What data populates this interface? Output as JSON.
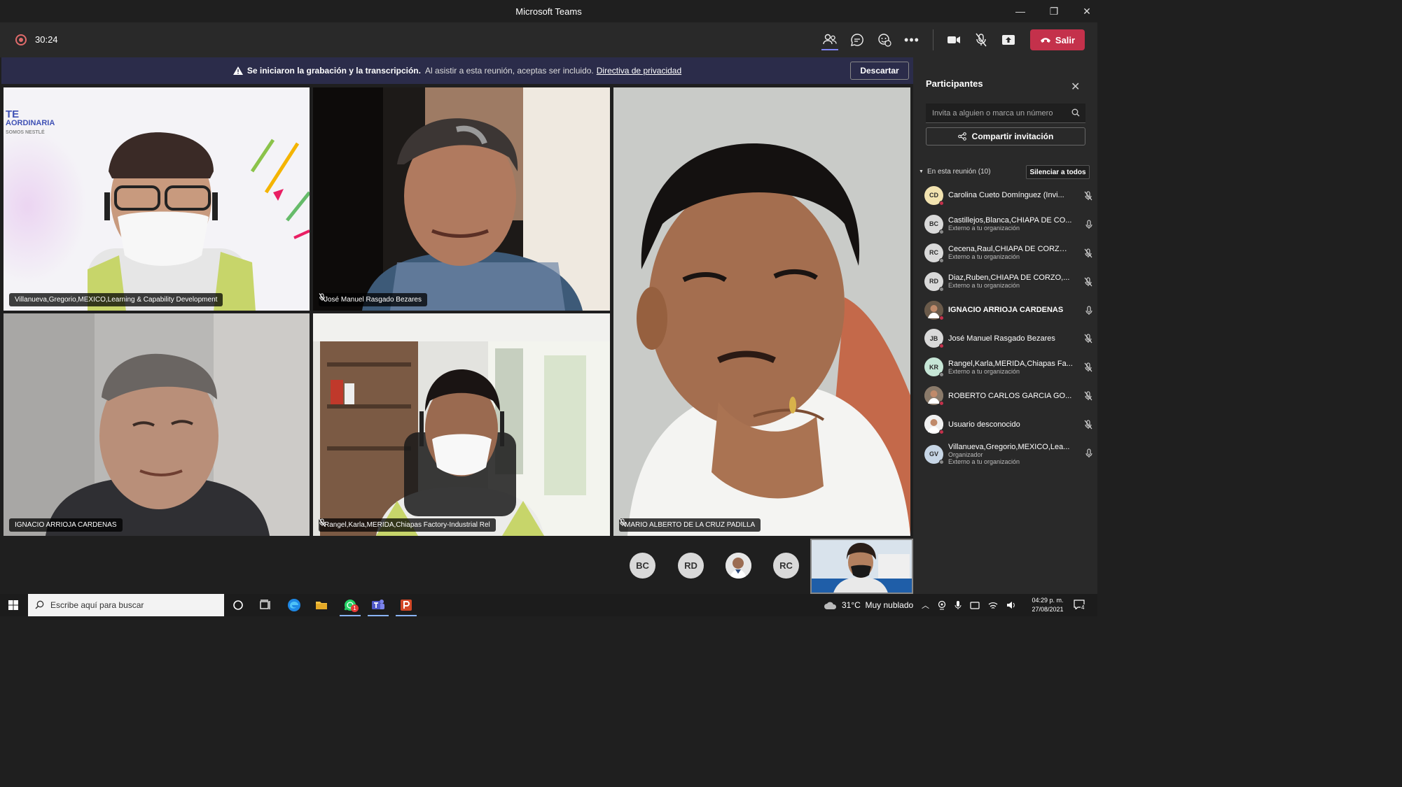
{
  "window": {
    "title": "Microsoft Teams",
    "minimize": "—",
    "maximize": "❐",
    "close": "✕"
  },
  "toolbar": {
    "timer": "30:24",
    "leave_label": "Salir"
  },
  "banner": {
    "bold_text": "Se iniciaron la grabación y la transcripción.",
    "text": "Al asistir a esta reunión, aceptas ser incluido.",
    "link_text": "Directiva de privacidad",
    "dismiss_label": "Descartar"
  },
  "video_tiles": [
    {
      "name": "Villanueva,Gregorio,MEXICO,Learning & Capability Development",
      "muted": false,
      "background_text": [
        "TE",
        "AORDINARIA",
        "SOMOS NESTLÉ"
      ]
    },
    {
      "name": "José Manuel Rasgado Bezares",
      "muted": true
    },
    {
      "name": "MARIO ALBERTO DE LA CRUZ PADILLA",
      "muted": true
    },
    {
      "name": "IGNACIO ARRIOJA CARDENAS",
      "muted": false
    },
    {
      "name": "Rangel,Karla,MERIDA,Chiapas Factory-Industrial Rel",
      "muted": true
    }
  ],
  "participants_panel": {
    "title": "Participantes",
    "invite_placeholder": "Invita a alguien o marca un número",
    "share_label": "Compartir invitación",
    "section_label": "En esta reunión (10)",
    "mute_all_label": "Silenciar a todos",
    "participants": [
      {
        "initials": "CD",
        "name": "Carolina Cueto Domínguez (Invi...",
        "sub": "",
        "sub2": "",
        "color": "#f2e3b0",
        "muted": true,
        "bold": false
      },
      {
        "initials": "BC",
        "name": "Castillejos,Blanca,CHIAPA DE CO...",
        "sub": "Externo a tu organización",
        "sub2": "",
        "color": "#d9d9d9",
        "muted": false,
        "bold": false
      },
      {
        "initials": "RC",
        "name": "Cecena,Raul,CHIAPA DE CORZO,...",
        "sub": "Externo a tu organización",
        "sub2": "",
        "color": "#d9d9d9",
        "muted": true,
        "bold": false
      },
      {
        "initials": "RD",
        "name": "Diaz,Ruben,CHIAPA DE CORZO,...",
        "sub": "Externo a tu organización",
        "sub2": "",
        "color": "#d9d9d9",
        "muted": true,
        "bold": false
      },
      {
        "initials": "",
        "name": "IGNACIO ARRIOJA CARDENAS",
        "sub": "",
        "sub2": "",
        "color": "#6a5a4a",
        "muted": false,
        "bold": true
      },
      {
        "initials": "JB",
        "name": "José Manuel Rasgado Bezares",
        "sub": "",
        "sub2": "",
        "color": "#d9d9d9",
        "muted": true,
        "bold": false
      },
      {
        "initials": "KR",
        "name": "Rangel,Karla,MERIDA,Chiapas Fa...",
        "sub": "Externo a tu organización",
        "sub2": "",
        "color": "#c6e6d6",
        "muted": true,
        "bold": false
      },
      {
        "initials": "",
        "name": "ROBERTO CARLOS GARCIA GO...",
        "sub": "",
        "sub2": "",
        "color": "#8a7a6a",
        "muted": true,
        "bold": false
      },
      {
        "initials": "",
        "name": "Usuario desconocido",
        "sub": "",
        "sub2": "",
        "color": "#f0f0f0",
        "muted": true,
        "bold": false
      },
      {
        "initials": "GV",
        "name": "Villanueva,Gregorio,MEXICO,Lea...",
        "sub": "Organizador",
        "sub2": "Externo a tu organización",
        "color": "#c7d6e6",
        "muted": false,
        "bold": false
      }
    ]
  },
  "bottom_strip": {
    "avatars": [
      "BC",
      "RD",
      "",
      "RC"
    ]
  },
  "taskbar": {
    "search_placeholder": "Escribe aquí para buscar",
    "weather": "31°C  Muy nublado",
    "time": "04:29 p. m.",
    "date": "27/08/2021",
    "notifications": "4",
    "whatsapp_badge": "1"
  }
}
